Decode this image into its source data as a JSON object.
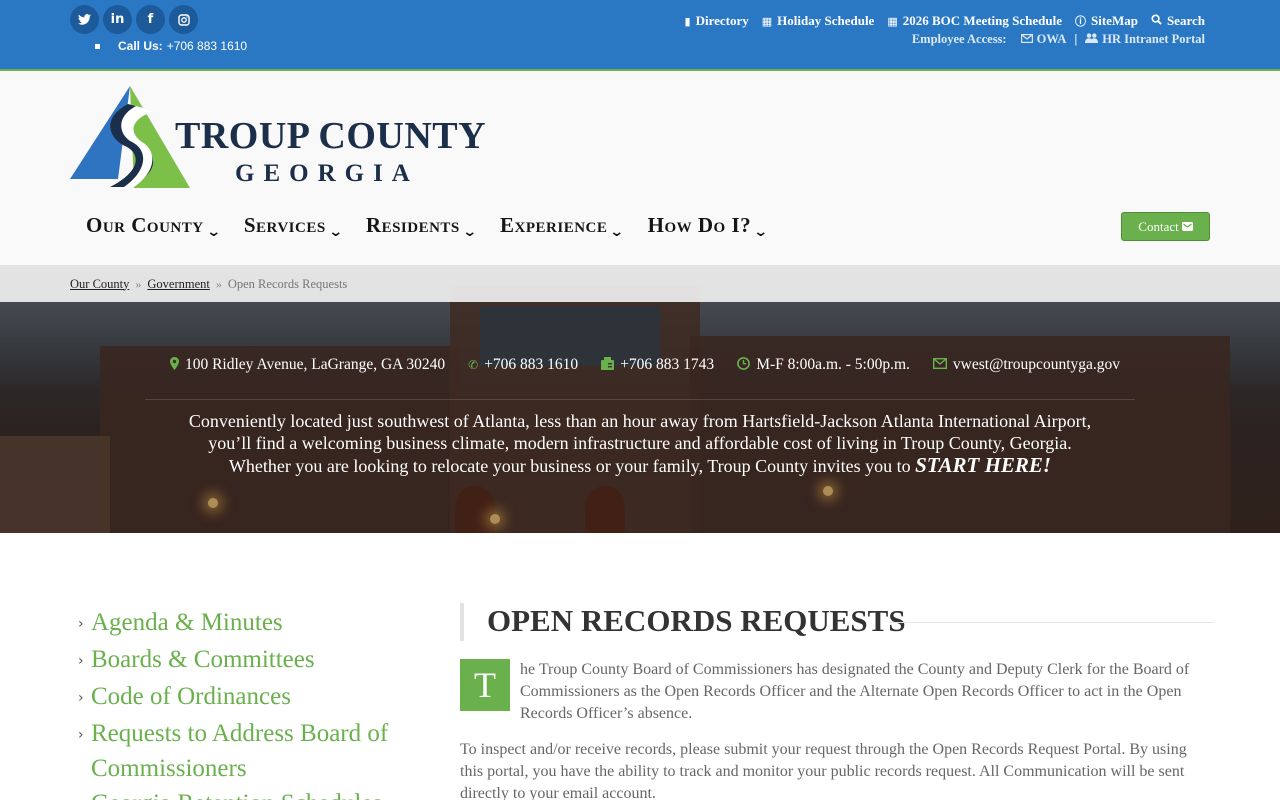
{
  "topbar": {
    "social": [
      "twitter-icon",
      "linkedin-icon",
      "facebook-icon",
      "instagram-icon"
    ],
    "call_label": "Call Us:",
    "call_number": "+706 883 1610",
    "links": [
      {
        "label": "Directory",
        "icon": "book-icon"
      },
      {
        "label": "Holiday Schedule",
        "icon": "calendar-icon"
      },
      {
        "label": "2026 BOC Meeting Schedule",
        "icon": "calendar-icon"
      },
      {
        "label": "SiteMap",
        "icon": "info-icon"
      },
      {
        "label": "Search",
        "icon": "search-icon"
      }
    ],
    "employee_label": "Employee Access:",
    "owa": "OWA",
    "hr_portal": "HR Intranet Portal",
    "separator": "|"
  },
  "logo": {
    "line1": "TROUP COUNTY",
    "line2": "GEORGIA"
  },
  "nav": {
    "items": [
      "Our County",
      "Services",
      "Residents",
      "Experience",
      "How Do I?"
    ],
    "contact": "Contact"
  },
  "breadcrumb": {
    "items": [
      "Our County",
      "Government"
    ],
    "current": "Open Records Requests",
    "separator": "»"
  },
  "hero": {
    "address": "100 Ridley Avenue, LaGrange, GA 30240",
    "phone": "+706 883 1610",
    "fax": "+706 883 1743",
    "hours": "M-F 8:00a.m. - 5:00p.m.",
    "email": "vwest@troupcountyga.gov",
    "tagline_line1": "Conveniently located just southwest of Atlanta, less than an hour away from Hartsfield-Jackson Atlanta International Airport,",
    "tagline_line2": "you’ll find a welcoming business climate, modern infrastructure and affordable cost of living in Troup County, Georgia.",
    "tagline_line3": "Whether you are looking to relocate your business or your family, Troup County invites you to",
    "tagline_start": "START HERE!"
  },
  "sidebar": {
    "items": [
      "Agenda & Minutes",
      "Boards & Committees",
      "Code of Ordinances",
      "Requests to Address Board of Commissioners",
      "Georgia Retention Schedules"
    ]
  },
  "main": {
    "title": "OPEN RECORDS REQUESTS",
    "dropcap": "T",
    "para1": "he Troup County Board of Commissioners has designated the County and Deputy Clerk for the Board of Commissioners as the Open Records Officer and the Alternate Open Records Officer to act in the Open Records Officer’s absence.",
    "para2": "To inspect and/or receive records, please submit your request through the Open Records Request Portal. By using this portal, you have the ability to track and monitor your public records request. All Communication will be sent directly to your email account."
  },
  "colors": {
    "topbar": "#2a78c4",
    "accent_green": "#6ab04c",
    "navy": "#1b2f4a"
  }
}
